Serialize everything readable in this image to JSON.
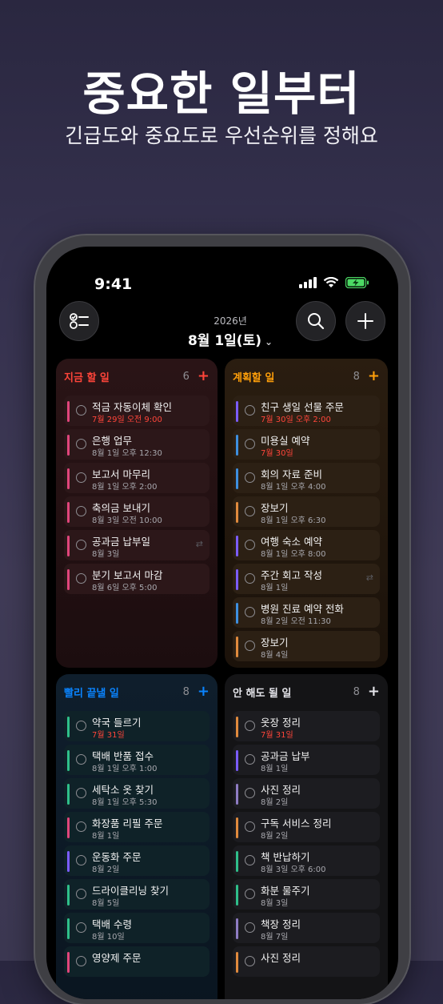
{
  "hero": {
    "title": "중요한 일부터",
    "subtitle": "긴급도와 중요도로 우선순위를 정해요"
  },
  "status_bar": {
    "time": "9:41"
  },
  "header": {
    "year": "2026년",
    "date": "8월 1일(토)",
    "chevron": "⌄"
  },
  "quadrants": [
    {
      "title": "지금 할 일",
      "count": "6",
      "add": "+",
      "accent": "#ff453a",
      "tasks": [
        {
          "title": "적금 자동이체 확인",
          "due": "7월 29일 오전 9:00",
          "overdue": true,
          "bar": "#e0457b",
          "repeat": false
        },
        {
          "title": "은행 업무",
          "due": "8월 1일 오후 12:30",
          "overdue": false,
          "bar": "#e0457b",
          "repeat": false
        },
        {
          "title": "보고서 마무리",
          "due": "8월 1일 오후 2:00",
          "overdue": false,
          "bar": "#e0457b",
          "repeat": false
        },
        {
          "title": "축의금 보내기",
          "due": "8월 3일 오전 10:00",
          "overdue": false,
          "bar": "#e0457b",
          "repeat": false
        },
        {
          "title": "공과금 납부일",
          "due": "8월 3일",
          "overdue": false,
          "bar": "#e0457b",
          "repeat": true
        },
        {
          "title": "분기 보고서 마감",
          "due": "8월 6일 오후 5:00",
          "overdue": false,
          "bar": "#e0457b",
          "repeat": false
        }
      ]
    },
    {
      "title": "계획할 일",
      "count": "8",
      "add": "+",
      "accent": "#ff9f0a",
      "tasks": [
        {
          "title": "친구 생일 선물 주문",
          "due": "7월 30일 오후 2:00",
          "overdue": true,
          "bar": "#7b5cff",
          "repeat": false
        },
        {
          "title": "미용실 예약",
          "due": "7월 30일",
          "overdue": true,
          "bar": "#3d8fe0",
          "repeat": false
        },
        {
          "title": "회의 자료 준비",
          "due": "8월 1일 오후 4:00",
          "overdue": false,
          "bar": "#3d8fe0",
          "repeat": false
        },
        {
          "title": "장보기",
          "due": "8월 1일 오후 6:30",
          "overdue": false,
          "bar": "#e08a3d",
          "repeat": false
        },
        {
          "title": "여행 숙소 예약",
          "due": "8월 1일 오후 8:00",
          "overdue": false,
          "bar": "#7b5cff",
          "repeat": false
        },
        {
          "title": "주간 회고 작성",
          "due": "8월 1일",
          "overdue": false,
          "bar": "#7b5cff",
          "repeat": true
        },
        {
          "title": "병원 진료 예약 전화",
          "due": "8월 2일 오전 11:30",
          "overdue": false,
          "bar": "#3d8fe0",
          "repeat": false
        },
        {
          "title": "장보기",
          "due": "8월 4일",
          "overdue": false,
          "bar": "#e08a3d",
          "repeat": false
        }
      ]
    },
    {
      "title": "빨리 끝낼 일",
      "count": "8",
      "add": "+",
      "accent": "#0a84ff",
      "tasks": [
        {
          "title": "약국 들르기",
          "due": "7월 31일",
          "overdue": true,
          "bar": "#2fbf8a",
          "repeat": false
        },
        {
          "title": "택배 반품 접수",
          "due": "8월 1일 오후 1:00",
          "overdue": false,
          "bar": "#2fbf8a",
          "repeat": false
        },
        {
          "title": "세탁소 옷 찾기",
          "due": "8월 1일 오후 5:30",
          "overdue": false,
          "bar": "#2fbf8a",
          "repeat": false
        },
        {
          "title": "화장품 리필 주문",
          "due": "8월 1일",
          "overdue": false,
          "bar": "#e0457b",
          "repeat": false
        },
        {
          "title": "운동화 주문",
          "due": "8월 2일",
          "overdue": false,
          "bar": "#7b5cff",
          "repeat": false
        },
        {
          "title": "드라이클리닝 찾기",
          "due": "8월 5일",
          "overdue": false,
          "bar": "#2fbf8a",
          "repeat": false
        },
        {
          "title": "택배 수령",
          "due": "8월 10일",
          "overdue": false,
          "bar": "#2fbf8a",
          "repeat": false
        },
        {
          "title": "영양제 주문",
          "due": "",
          "overdue": false,
          "bar": "#e0457b",
          "repeat": false
        }
      ]
    },
    {
      "title": "안 해도 될 일",
      "count": "8",
      "add": "+",
      "accent": "#e5e5ea",
      "tasks": [
        {
          "title": "옷장 정리",
          "due": "7월 31일",
          "overdue": true,
          "bar": "#e08a3d",
          "repeat": false
        },
        {
          "title": "공과금 납부",
          "due": "8월 1일",
          "overdue": false,
          "bar": "#7b5cff",
          "repeat": false
        },
        {
          "title": "사진 정리",
          "due": "8월 2일",
          "overdue": false,
          "bar": "#8e7cc3",
          "repeat": false
        },
        {
          "title": "구독 서비스 정리",
          "due": "8월 2일",
          "overdue": false,
          "bar": "#e08a3d",
          "repeat": false
        },
        {
          "title": "책 반납하기",
          "due": "8월 3일 오후 6:00",
          "overdue": false,
          "bar": "#2fbf8a",
          "repeat": false
        },
        {
          "title": "화분 물주기",
          "due": "8월 3일",
          "overdue": false,
          "bar": "#2fbf8a",
          "repeat": false
        },
        {
          "title": "책장 정리",
          "due": "8월 7일",
          "overdue": false,
          "bar": "#8e7cc3",
          "repeat": false
        },
        {
          "title": "사진 정리",
          "due": "",
          "overdue": false,
          "bar": "#e08a3d",
          "repeat": false
        }
      ]
    }
  ]
}
